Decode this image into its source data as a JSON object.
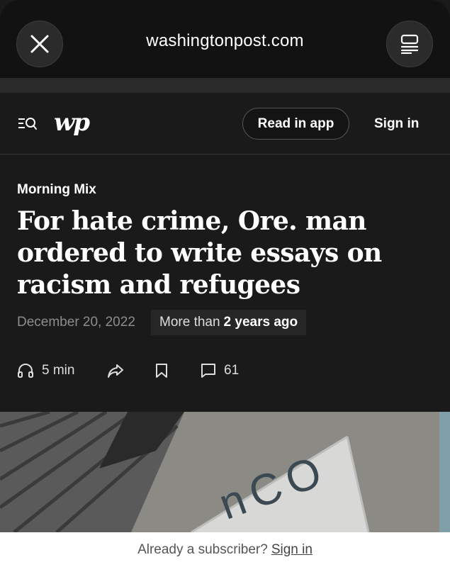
{
  "browser": {
    "url": "washingtonpost.com",
    "close_icon": "close-icon",
    "reader_icon": "reader-mode-icon"
  },
  "header": {
    "logo_text": "wp",
    "read_in_app": "Read in app",
    "sign_in": "Sign in"
  },
  "article": {
    "kicker": "Morning Mix",
    "headline": "For hate crime, Ore. man ordered to write essays on racism and refugees",
    "date": "December 20, 2022",
    "age_prefix": "More than",
    "age_bold": "2 years ago"
  },
  "tools": {
    "listen_duration": "5 min",
    "comment_count": "61"
  },
  "hero": {
    "sign_text": "nCO"
  },
  "footer": {
    "prompt": "Already a subscriber?",
    "sign_in_link": "Sign in"
  },
  "colors": {
    "background": "#1a1a1a",
    "browser_bar": "#121212",
    "footer_bg": "#ffffff"
  }
}
